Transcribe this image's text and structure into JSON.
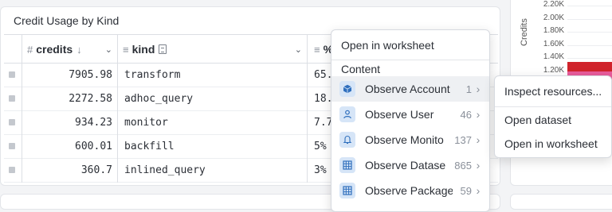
{
  "panel": {
    "title": "Credit Usage by Kind"
  },
  "table": {
    "columns": {
      "credits": "credits",
      "kind": "kind",
      "pct": "%"
    },
    "rows": [
      {
        "credits": "7905.98",
        "kind": "transform",
        "pct": "65."
      },
      {
        "credits": "2272.58",
        "kind": "adhoc_query",
        "pct": "18."
      },
      {
        "credits": "934.23",
        "kind": "monitor",
        "pct": "7.7"
      },
      {
        "credits": "600.01",
        "kind": "backfill",
        "pct": "5%"
      },
      {
        "credits": "360.7",
        "kind": "inlined_query",
        "pct": "3%"
      }
    ]
  },
  "chart": {
    "ylabel": "Credits",
    "ticks": [
      "2.20K",
      "2.00K",
      "1.80K",
      "1.60K",
      "1.40K",
      "1.20K"
    ]
  },
  "chart_data": {
    "type": "bar",
    "ylabel": "Credits",
    "ticks": [
      "2.20K",
      "2.00K",
      "1.80K",
      "1.60K",
      "1.40K",
      "1.20K"
    ],
    "series_colors": [
      "#d0232b",
      "#e85c9b"
    ]
  },
  "menu": {
    "open_worksheet": "Open in worksheet",
    "content_label": "Content",
    "items": [
      {
        "name": "Observe Account",
        "count": "1",
        "icon": "cube-icon"
      },
      {
        "name": "Observe User",
        "count": "46",
        "icon": "user-icon"
      },
      {
        "name": "Observe Monito",
        "count": "137",
        "icon": "bell-icon"
      },
      {
        "name": "Observe Datase",
        "count": "865",
        "icon": "table-icon"
      },
      {
        "name": "Observe Package",
        "count": "59",
        "icon": "table-icon"
      }
    ]
  },
  "submenu": {
    "inspect": "Inspect resources...",
    "open_dataset": "Open dataset",
    "open_worksheet": "Open in worksheet"
  },
  "colors": {
    "accent_red": "#d0232b",
    "accent_pink": "#e85c9b",
    "icon_blue": "#2f6fbd"
  }
}
